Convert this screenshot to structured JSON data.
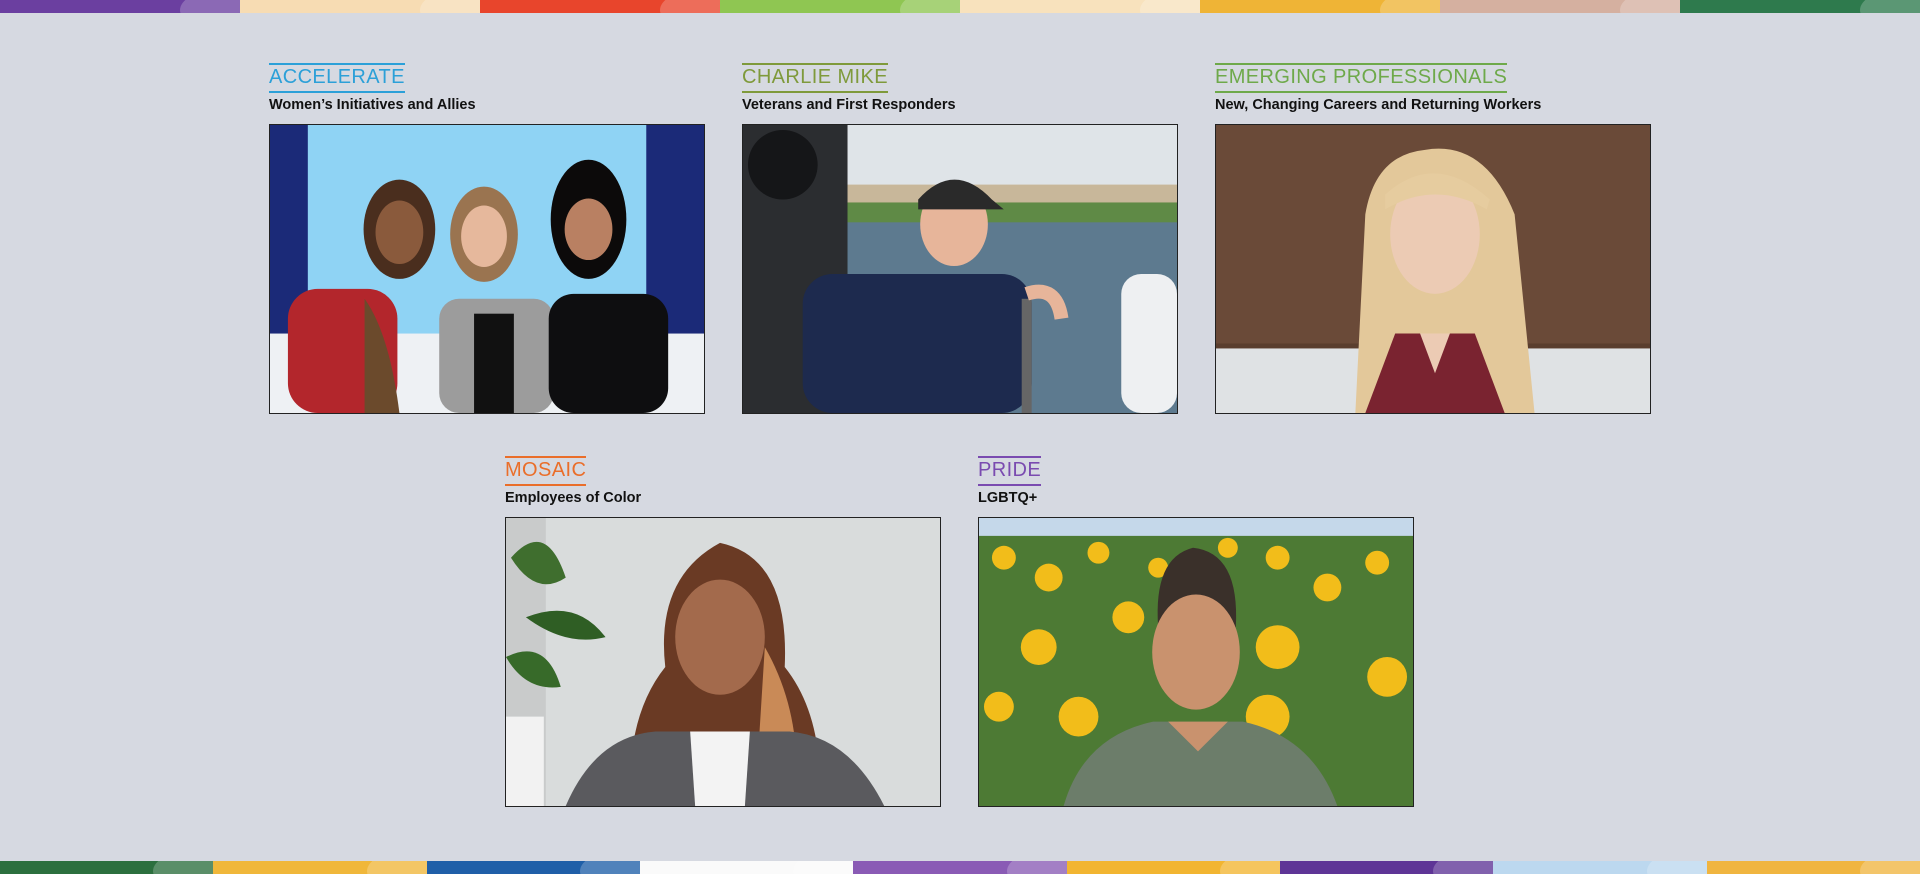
{
  "top_stripe": [
    "#6b3fa0",
    "#f7dcb3",
    "#e8452c",
    "#8fc652",
    "#f8e2bd",
    "#efb436",
    "#d5b0a0",
    "#2e7a4d"
  ],
  "bottom_stripe": [
    "#2c6f3e",
    "#f0b73a",
    "#1f5fa8",
    "#fafafa",
    "#8a5bb5",
    "#f2b531",
    "#5e3596",
    "#bcd8ef",
    "#f0b540"
  ],
  "cards": [
    {
      "title": "ACCELERATE",
      "subtitle": "Women’s Initiatives and Allies",
      "accent": "#2ca0d8"
    },
    {
      "title": "CHARLIE MIKE",
      "subtitle": "Veterans and First Responders",
      "accent": "#7f9a3b"
    },
    {
      "title": "EMERGING PROFESSIONALS",
      "subtitle": "New, Changing Careers and Returning Workers",
      "accent": "#6ea94a"
    },
    {
      "title": "MOSAIC",
      "subtitle": "Employees of Color",
      "accent": "#ea6e2a"
    },
    {
      "title": "PRIDE",
      "subtitle": "LGBTQ+",
      "accent": "#7a4bb0"
    }
  ]
}
